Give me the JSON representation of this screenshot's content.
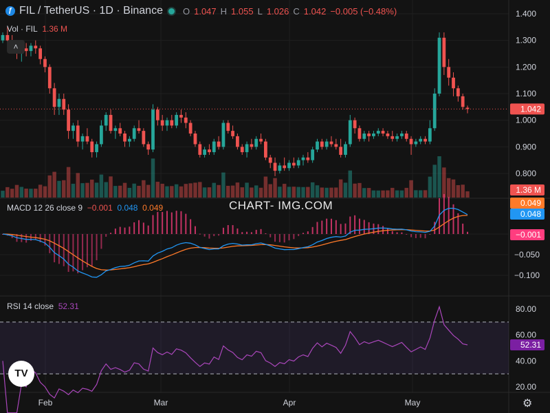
{
  "header": {
    "title": "FIL / TetherUS · 1D · Binance",
    "open_label": "O",
    "open": "1.047",
    "high_label": "H",
    "high": "1.055",
    "low_label": "L",
    "low": "1.026",
    "close_label": "C",
    "close": "1.042",
    "change": "−0.005 (−0.48%)"
  },
  "volume_legend": {
    "label": "Vol · FIL",
    "value": "1.36 M"
  },
  "macd_legend": {
    "label": "MACD 12 26 close 9",
    "hist": "−0.001",
    "macd": "0.048",
    "signal": "0.049"
  },
  "rsi_legend": {
    "label": "RSI 14 close",
    "value": "52.31"
  },
  "watermark": "CHART- IMG.COM",
  "badges": {
    "price": "1.042",
    "volume": "1.36 M",
    "signal": "0.049",
    "macd": "0.048",
    "hist": "−0.001",
    "rsi": "52.31"
  },
  "colors": {
    "up": "#26a69a",
    "down": "#ef5350",
    "macd": "#2196f3",
    "signal": "#ff7a29",
    "hist_pos": "#ff3d7f",
    "rsi": "#ab47bc",
    "grid": "#1f1f1f",
    "background": "#131313"
  },
  "chart_data": [
    {
      "type": "candlestick",
      "title": "FIL / TetherUS · 1D · Binance",
      "ylim": [
        0.76,
        1.43
      ],
      "y_ticks": [
        "1.400",
        "1.300",
        "1.200",
        "1.100",
        "1.000",
        "0.900",
        "0.800"
      ],
      "x_ticks": [
        "Feb",
        "Mar",
        "Apr",
        "May"
      ],
      "last_price": 1.042,
      "candles": [
        [
          1.3,
          1.33,
          1.29,
          1.32
        ],
        [
          1.32,
          1.35,
          1.29,
          1.3
        ],
        [
          1.3,
          1.32,
          1.27,
          1.28
        ],
        [
          1.28,
          1.3,
          1.23,
          1.25
        ],
        [
          1.25,
          1.28,
          1.22,
          1.27
        ],
        [
          1.27,
          1.29,
          1.24,
          1.26
        ],
        [
          1.26,
          1.29,
          1.24,
          1.28
        ],
        [
          1.28,
          1.3,
          1.25,
          1.27
        ],
        [
          1.27,
          1.28,
          1.21,
          1.23
        ],
        [
          1.23,
          1.24,
          1.18,
          1.2
        ],
        [
          1.2,
          1.21,
          1.1,
          1.12
        ],
        [
          1.12,
          1.14,
          1.02,
          1.05
        ],
        [
          1.05,
          1.1,
          1.02,
          1.08
        ],
        [
          1.08,
          1.1,
          1.02,
          1.04
        ],
        [
          1.04,
          1.06,
          0.93,
          0.96
        ],
        [
          0.96,
          0.99,
          0.93,
          0.98
        ],
        [
          0.98,
          1.0,
          0.9,
          0.92
        ],
        [
          0.92,
          0.95,
          0.89,
          0.94
        ],
        [
          0.94,
          0.97,
          0.91,
          0.92
        ],
        [
          0.92,
          0.93,
          0.86,
          0.88
        ],
        [
          0.88,
          0.92,
          0.86,
          0.91
        ],
        [
          0.91,
          1.0,
          0.9,
          0.98
        ],
        [
          0.98,
          1.03,
          0.96,
          1.02
        ],
        [
          1.02,
          1.04,
          0.95,
          0.96
        ],
        [
          0.96,
          0.98,
          0.93,
          0.97
        ],
        [
          0.97,
          0.99,
          0.94,
          0.95
        ],
        [
          0.95,
          0.96,
          0.9,
          0.92
        ],
        [
          0.92,
          0.94,
          0.9,
          0.93
        ],
        [
          0.93,
          0.98,
          0.92,
          0.97
        ],
        [
          0.97,
          1.0,
          0.95,
          0.96
        ],
        [
          0.96,
          0.97,
          0.9,
          0.91
        ],
        [
          0.91,
          0.92,
          0.87,
          0.89
        ],
        [
          0.89,
          1.06,
          0.88,
          1.04
        ],
        [
          1.04,
          1.05,
          0.98,
          1.0
        ],
        [
          1.0,
          1.02,
          0.96,
          0.98
        ],
        [
          0.98,
          1.01,
          0.96,
          1.0
        ],
        [
          1.0,
          1.02,
          0.97,
          0.98
        ],
        [
          0.98,
          1.03,
          0.97,
          1.02
        ],
        [
          1.02,
          1.04,
          0.99,
          1.01
        ],
        [
          1.01,
          1.03,
          0.97,
          0.99
        ],
        [
          0.99,
          1.0,
          0.94,
          0.95
        ],
        [
          0.95,
          0.96,
          0.9,
          0.91
        ],
        [
          0.91,
          0.92,
          0.86,
          0.87
        ],
        [
          0.87,
          0.9,
          0.86,
          0.89
        ],
        [
          0.89,
          0.91,
          0.87,
          0.88
        ],
        [
          0.88,
          0.93,
          0.87,
          0.92
        ],
        [
          0.92,
          0.94,
          0.89,
          0.9
        ],
        [
          0.9,
          1.0,
          0.89,
          0.99
        ],
        [
          0.99,
          1.0,
          0.95,
          0.96
        ],
        [
          0.96,
          0.98,
          0.93,
          0.94
        ],
        [
          0.94,
          0.95,
          0.89,
          0.9
        ],
        [
          0.9,
          0.91,
          0.87,
          0.88
        ],
        [
          0.88,
          0.92,
          0.86,
          0.91
        ],
        [
          0.91,
          0.93,
          0.89,
          0.9
        ],
        [
          0.9,
          0.94,
          0.89,
          0.93
        ],
        [
          0.93,
          0.95,
          0.91,
          0.92
        ],
        [
          0.92,
          0.93,
          0.85,
          0.86
        ],
        [
          0.86,
          0.87,
          0.82,
          0.84
        ],
        [
          0.84,
          0.86,
          0.79,
          0.81
        ],
        [
          0.81,
          0.84,
          0.8,
          0.83
        ],
        [
          0.83,
          0.86,
          0.81,
          0.82
        ],
        [
          0.82,
          0.85,
          0.81,
          0.84
        ],
        [
          0.84,
          0.86,
          0.82,
          0.83
        ],
        [
          0.83,
          0.86,
          0.82,
          0.85
        ],
        [
          0.85,
          0.87,
          0.83,
          0.86
        ],
        [
          0.86,
          0.88,
          0.84,
          0.85
        ],
        [
          0.85,
          0.9,
          0.84,
          0.89
        ],
        [
          0.89,
          0.93,
          0.88,
          0.92
        ],
        [
          0.92,
          0.93,
          0.89,
          0.9
        ],
        [
          0.9,
          0.93,
          0.89,
          0.92
        ],
        [
          0.92,
          0.94,
          0.9,
          0.91
        ],
        [
          0.91,
          0.93,
          0.89,
          0.9
        ],
        [
          0.9,
          0.93,
          0.86,
          0.87
        ],
        [
          0.87,
          0.92,
          0.86,
          0.91
        ],
        [
          0.91,
          1.02,
          0.9,
          1.0
        ],
        [
          1.0,
          1.01,
          0.95,
          0.97
        ],
        [
          0.97,
          0.98,
          0.92,
          0.93
        ],
        [
          0.93,
          0.96,
          0.92,
          0.95
        ],
        [
          0.95,
          0.96,
          0.92,
          0.94
        ],
        [
          0.94,
          0.96,
          0.93,
          0.95
        ],
        [
          0.95,
          0.97,
          0.94,
          0.96
        ],
        [
          0.96,
          0.97,
          0.94,
          0.95
        ],
        [
          0.95,
          0.96,
          0.93,
          0.94
        ],
        [
          0.94,
          0.96,
          0.92,
          0.93
        ],
        [
          0.93,
          0.95,
          0.92,
          0.94
        ],
        [
          0.94,
          0.96,
          0.93,
          0.95
        ],
        [
          0.95,
          0.96,
          0.92,
          0.93
        ],
        [
          0.93,
          0.94,
          0.87,
          0.91
        ],
        [
          0.91,
          0.93,
          0.9,
          0.92
        ],
        [
          0.92,
          0.94,
          0.91,
          0.93
        ],
        [
          0.93,
          0.94,
          0.91,
          0.92
        ],
        [
          0.92,
          1.0,
          0.91,
          0.97
        ],
        [
          0.97,
          1.12,
          0.96,
          1.1
        ],
        [
          1.1,
          1.33,
          1.09,
          1.31
        ],
        [
          1.31,
          1.33,
          1.17,
          1.2
        ],
        [
          1.2,
          1.23,
          1.13,
          1.16
        ],
        [
          1.16,
          1.18,
          1.09,
          1.12
        ],
        [
          1.12,
          1.13,
          1.07,
          1.09
        ],
        [
          1.09,
          1.1,
          1.04,
          1.05
        ],
        [
          1.047,
          1.055,
          1.026,
          1.042
        ]
      ]
    },
    {
      "type": "bar",
      "title": "Vol · FIL",
      "last_value": "1.36 M"
    },
    {
      "type": "line",
      "title": "MACD 12 26 close 9",
      "ylim": [
        -0.13,
        0.065
      ],
      "y_ticks": [
        "0.000",
        "−0.050",
        "−0.100"
      ]
    },
    {
      "type": "line",
      "title": "RSI 14 close",
      "ylim": [
        15,
        90
      ],
      "y_ticks": [
        "80.00",
        "60.00",
        "40.00",
        "20.00"
      ],
      "bands": [
        30,
        70
      ]
    }
  ]
}
